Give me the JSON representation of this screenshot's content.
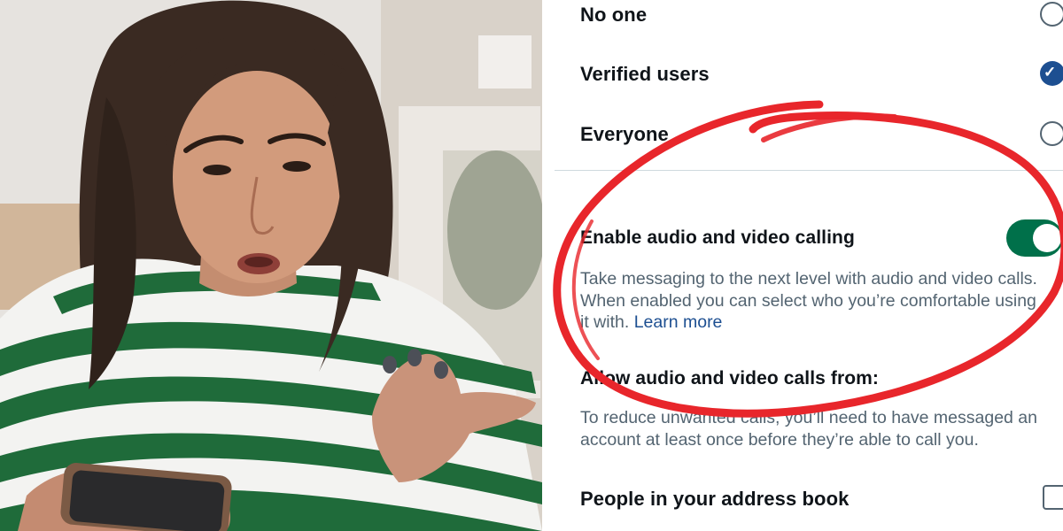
{
  "photo": {
    "subject": "woman-looking-at-phone"
  },
  "settings": {
    "options": [
      {
        "label": "No one",
        "checked": false
      },
      {
        "label": "Verified users",
        "checked": true
      },
      {
        "label": "Everyone",
        "checked": false
      }
    ],
    "check_mark": "✓",
    "calling": {
      "title": "Enable audio and video calling",
      "enabled": true,
      "description_lines": [
        "Take messaging to the next level with audio and video calls.",
        "When enabled you can select who you’re comfortable using"
      ],
      "description_tail": "it with.",
      "learn_more": "Learn more"
    },
    "allow_from": {
      "title": "Allow audio and video calls from:",
      "description_lines": [
        "To reduce unwanted calls, you’ll need to have messaged an",
        "account at least once before they’re able to call you."
      ]
    },
    "address_book": {
      "label": "People in your address book",
      "checked": false
    }
  },
  "colors": {
    "annotation_red": "#e8262b",
    "toggle_green": "#00704a",
    "checked_blue": "#1d4f91",
    "text_primary": "#0f1419",
    "text_secondary": "#536471"
  }
}
